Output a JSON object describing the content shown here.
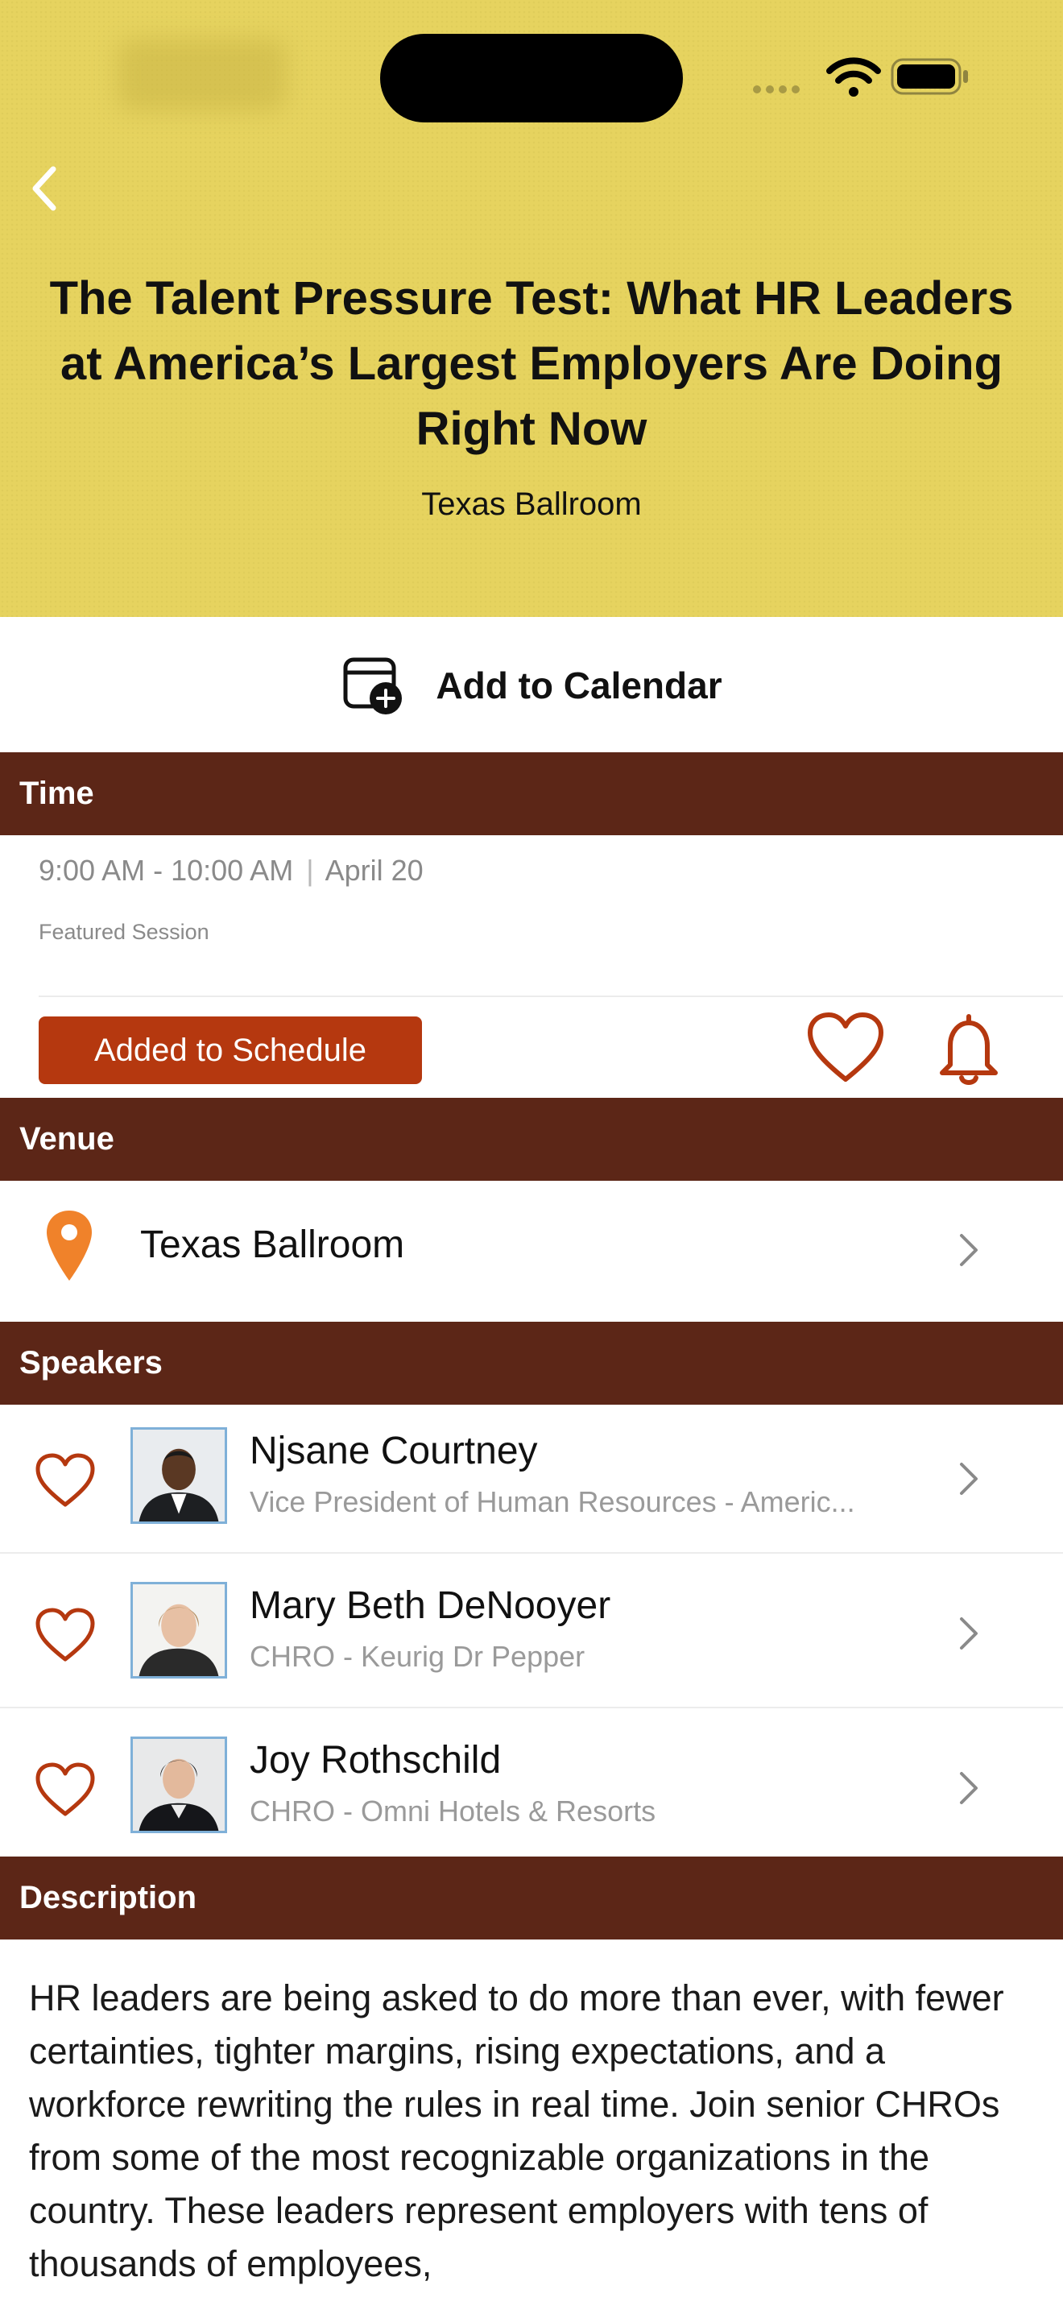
{
  "header": {
    "title": "The Talent Pressure Test: What HR Leaders at America’s Largest Employers Are Doing Right Now",
    "room": "Texas Ballroom"
  },
  "calendar": {
    "label": "Add to Calendar"
  },
  "sections": {
    "time": "Time",
    "venue": "Venue",
    "speakers": "Speakers",
    "description": "Description"
  },
  "time": {
    "range": "9:00 AM - 10:00 AM",
    "separator": "|",
    "date": "April 20",
    "tag": "Featured Session"
  },
  "schedule": {
    "button_label": "Added to Schedule"
  },
  "venue": {
    "name": "Texas Ballroom"
  },
  "speakers": [
    {
      "name": "Njsane Courtney",
      "role": "Vice President of Human Resources - Americ..."
    },
    {
      "name": "Mary Beth DeNooyer",
      "role": "CHRO - Keurig Dr Pepper"
    },
    {
      "name": "Joy Rothschild",
      "role": "CHRO - Omni Hotels & Resorts"
    }
  ],
  "description": {
    "text": "HR leaders are being asked to do more than ever, with fewer certainties, tighter margins, rising expectations, and a workforce rewriting the rules in real time. Join senior CHROs from some of the most recognizable organizations in the country. These leaders represent employers with tens of thousands of employees,"
  },
  "colors": {
    "hero_background": "#e6d35f",
    "section_header": "#5c2617",
    "accent": "#b5380f",
    "pin": "#f0822a"
  },
  "icons": {
    "back": "chevron-left-icon",
    "calendar": "calendar-add-icon",
    "favorite": "heart-outline-icon",
    "reminder": "bell-icon",
    "location": "map-pin-icon",
    "disclosure": "chevron-right-icon"
  }
}
